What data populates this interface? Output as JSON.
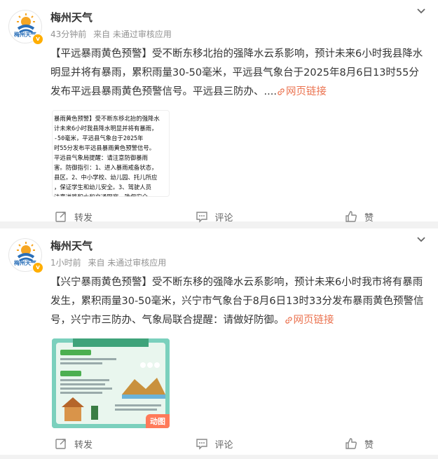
{
  "posts": [
    {
      "author": "梅州天气",
      "avatar_label": "梅州天气",
      "time": "43分钟前",
      "source": "来自 未通过审核应用",
      "text": "【平远暴雨黄色预警】受不断东移北抬的强降水云系影响，预计未来6小时我县降水明显并将有暴雨，累积雨量30-50毫米，平远县气象台于2025年8月6日13时55分发布平远县暴雨黄色预警信号。平远县三防办、....",
      "link_text": "网页链接",
      "image_lines": [
        "暴雨黄色预警】受不断东移北抬的强降水",
        "计未来6小时我县降水明显并将有暴雨，",
        "-50毫米，平远县气象台于2025年",
        "时55分发布平远县暴雨黄色预警信号。",
        "  平远县气象局提醒：请注意防御暴雨",
        "害。防御指引：1、进入暴雨戒备状态，",
        "县区。2、中小学校、幼儿园、托儿所应",
        "，保证学生和幼儿安全。3、驾驶人员",
        "注意道路积水和交通阻塞，确保安全。",
        "积水交通阻塞，确保安全。4、做好",
        "的排水防涝工作。"
      ],
      "actions": {
        "repost": "转发",
        "comment": "评论",
        "like": "赞"
      }
    },
    {
      "author": "梅州天气",
      "avatar_label": "梅州天气",
      "time": "1小时前",
      "source": "来自 未通过审核应用",
      "text": "【兴宁暴雨黄色预警】受不断东移的强降水云系影响，预计未来6小时我市将有暴雨发生，累积雨量30-50毫米，兴宁市气象台于8月6日13时33分发布暴雨黄色预警信号，兴宁市三防办、气象局联合提醒：请做好防御。",
      "link_text": "网页链接",
      "gif_badge": "动图",
      "actions": {
        "repost": "转发",
        "comment": "评论",
        "like": "赞"
      }
    }
  ],
  "colors": {
    "link": "#eb7350",
    "meta": "#939393",
    "verified": "#ffae00",
    "background": "#f2f2f2"
  }
}
